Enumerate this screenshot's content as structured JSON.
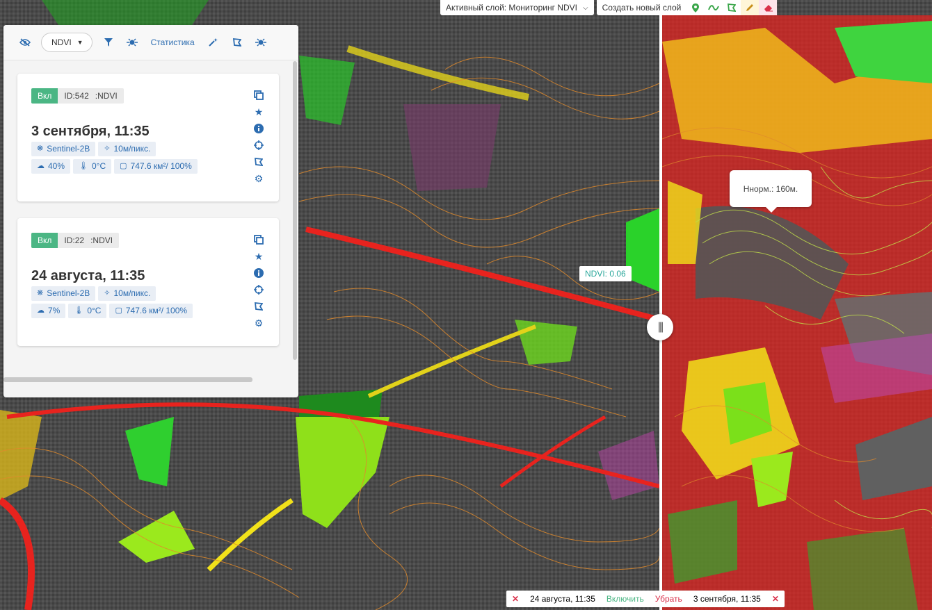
{
  "topbar": {
    "active_layer": "Активный слой: Мониторинг NDVI",
    "create_layer": "Создать новый слой",
    "tools": [
      {
        "icon": "map-pin-icon",
        "color": "#4bb684"
      },
      {
        "icon": "line-icon",
        "color": "#4bb684"
      },
      {
        "icon": "polygon-icon",
        "color": "#4bb684"
      },
      {
        "icon": "pencil-icon",
        "color": "#d9a400"
      },
      {
        "icon": "eraser-icon",
        "color": "#d9304a"
      }
    ]
  },
  "panel": {
    "toolbar": {
      "index_select": "NDVI",
      "statistics": "Статистика"
    },
    "cards": [
      {
        "status": "Вкл",
        "id": "ID:542",
        "index": ":NDVI",
        "title": "3 сентября, 11:35",
        "satellite": "Sentinel-2B",
        "resolution": "10м/пикс.",
        "cloud": "40%",
        "temperature": "0°C",
        "area": "747.6 км²/ 100%"
      },
      {
        "status": "Вкл",
        "id": "ID:22",
        "index": ":NDVI",
        "title": "24 августа, 11:35",
        "satellite": "Sentinel-2B",
        "resolution": "10м/пикс.",
        "cloud": "7%",
        "temperature": "0°C",
        "area": "747.6 км²/ 100%"
      }
    ]
  },
  "map": {
    "ndvi_tooltip": "NDVI: 0.06",
    "norm_bubble": "Нн​орм.: 160м."
  },
  "compare_bar": {
    "left_date": "24 августа, 11:35",
    "enable": "Включить",
    "remove": "Убрать",
    "right_date": "3 сентября, 11:35"
  },
  "colors": {
    "accent": "#2c6cb0",
    "status_on": "#4bb684",
    "remove": "#d9304a",
    "ndvi_high": "#1fc81f",
    "ndvi_mid": "#f2e21a",
    "ndvi_low": "#e8231e",
    "contour": "#e08a2c"
  }
}
